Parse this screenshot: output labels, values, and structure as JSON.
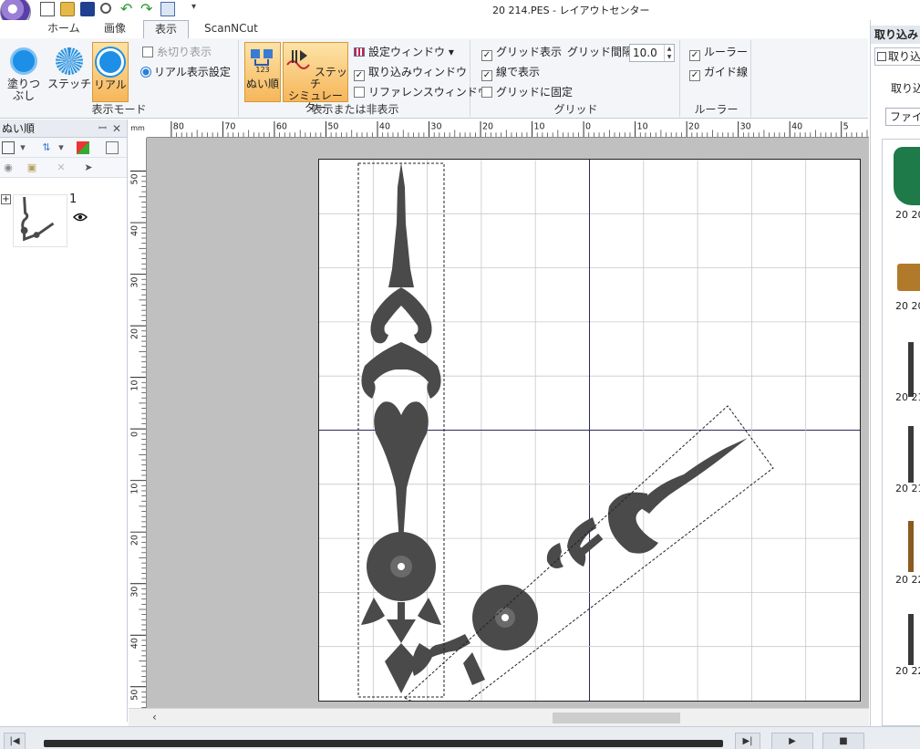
{
  "window": {
    "title": "20 214.PES - レイアウトセンター"
  },
  "tabs": [
    {
      "label": "ホーム"
    },
    {
      "label": "画像"
    },
    {
      "label": "表示"
    },
    {
      "label": "ScanNCut"
    }
  ],
  "ribbon": {
    "display_mode": {
      "label": "表示モード",
      "fill_label": "塗りつぶし",
      "stitch_label": "ステッチ",
      "real_label": "リアル",
      "thread_cut_label": "糸切り表示",
      "real_settings_label": "リアル表示設定"
    },
    "show_hide": {
      "label": "表示または非表示",
      "sew_order_label": "ぬい順",
      "simulator_label_1": "ステッチ",
      "simulator_label_2": "シミュレーター",
      "settings_window_label": "設定ウィンドウ ▾",
      "import_window_label": "取り込みウィンドウ",
      "reference_window_label": "リファレンスウィンドウ"
    },
    "grid": {
      "label": "グリッド",
      "show_grid_label": "グリッド表示",
      "line_display_label": "線で表示",
      "snap_grid_label": "グリッドに固定",
      "spacing_label": "グリッド間隔:",
      "spacing_value": "10.0"
    },
    "ruler": {
      "label": "ルーラー",
      "ruler_label": "ルーラー",
      "guide_label": "ガイド線"
    }
  },
  "sew_order_panel": {
    "title": "ぬい順",
    "pin_glyph": "ꟷ",
    "close_glyph": "✕",
    "item_number": "1"
  },
  "ruler": {
    "unit": "mm",
    "top_labels": [
      "80",
      "70",
      "60",
      "50",
      "40",
      "30",
      "20",
      "10",
      "0",
      "10",
      "20",
      "30",
      "40",
      "5"
    ],
    "left_labels": [
      "50",
      "40",
      "30",
      "20",
      "10",
      "0",
      "10",
      "20",
      "30",
      "40",
      "50"
    ]
  },
  "import_panel": {
    "title": "取り込み",
    "tab_label": "取り込",
    "label": "取り込",
    "combo_label": "ファイル",
    "items": [
      "20 20",
      "20 20",
      "20 21",
      "20 21",
      "20 22",
      "20 22"
    ]
  },
  "colors": {
    "accent": "#1d8fe6",
    "active_button": "#f6b65a",
    "embroidery": "#4a4a4a",
    "grid_line": "#c8c8c8"
  }
}
